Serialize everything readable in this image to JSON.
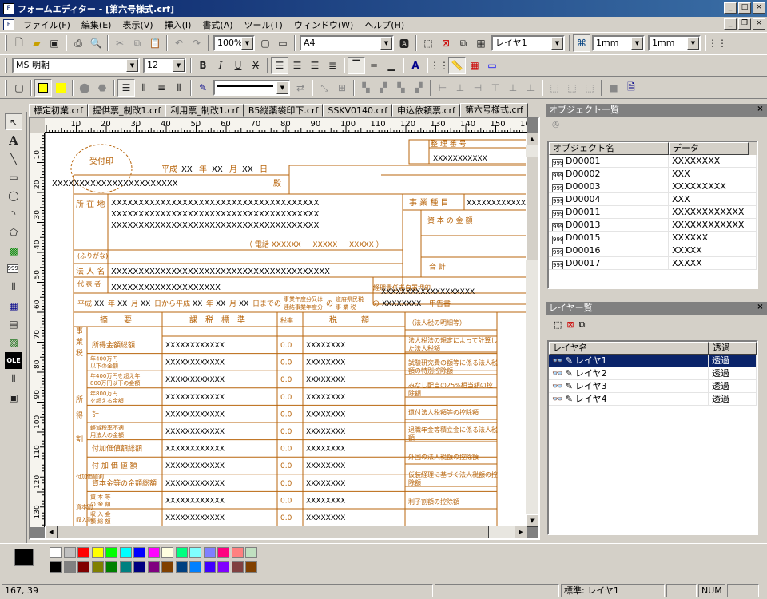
{
  "window": {
    "title": "フォームエディター - [第六号様式.crf]"
  },
  "menu": [
    "ファイル(F)",
    "編集(E)",
    "表示(V)",
    "挿入(I)",
    "書式(A)",
    "ツール(T)",
    "ウィンドウ(W)",
    "ヘルプ(H)"
  ],
  "toolbar1": {
    "zoom": "100%",
    "paper": "A4",
    "layer": "レイヤ1",
    "grid_x": "1mm",
    "grid_y": "1mm"
  },
  "toolbar2": {
    "font": "MS 明朝",
    "size": "12",
    "bold": "B",
    "italic": "I",
    "underline": "U",
    "strike": "X"
  },
  "tabs": [
    "標定初業.crf",
    "提供票_制改1.crf",
    "利用票_制改1.crf",
    "B5縦薬袋印下.crf",
    "SSKV0140.crf",
    "申込依頼票.crf",
    "第六号様式.crf"
  ],
  "ruler": {
    "h": [
      "10",
      "20",
      "30",
      "40",
      "50",
      "60",
      "70",
      "80",
      "90",
      "100",
      "110",
      "120",
      "130",
      "140",
      "150",
      "160"
    ],
    "v": [
      "10",
      "20",
      "30",
      "40",
      "50",
      "60",
      "70",
      "80",
      "90",
      "100",
      "110",
      "120",
      "130"
    ]
  },
  "form": {
    "stamp": "受付印",
    "heisei": "平成",
    "date_fields": [
      "XX",
      "年",
      "XX",
      "月",
      "XX",
      "日"
    ],
    "tax_office": "XXXXXXXXXXXXXXXXXXXXXXX",
    "tono": "殿",
    "addr_label": "所 在 地",
    "addr_lines": [
      "XXXXXXXXXXXXXXXXXXXXXXXXXXXXXXXXXXXXXX",
      "XXXXXXXXXXXXXXXXXXXXXXXXXXXXXXXXXXXXXX",
      "XXXXXXXXXXXXXXXXXXXXXXXXXXXXXXXXXXXXXX"
    ],
    "tel": "（ 電話 XXXXXX － XXXXX － XXXXX ）",
    "furigana": "(ふりがな)",
    "corp_label": "法 人 名",
    "corp_value": "XXXXXXXXXXXXXXXXXXXXXXXXXXXXXXXXXXXXXXXX",
    "rep_label": "代 表 者",
    "rep_value": "XXXXXXXXXXXXXXXXXXXX",
    "jigyo": "事 業 種 目",
    "jigyo_value": "XXXXXXXXXXXX",
    "shihon": "資 本 の 金 額",
    "gokei": "合 計",
    "keiri": "経理責任者自署押印",
    "keiri_value": "XXXXXXXXXXXXXXXXXXX",
    "seiri": "整 理 番 号",
    "seiri_value": "XXXXXXXXXXX",
    "period_line": [
      "平成",
      "XX",
      "年",
      "XX",
      "月",
      "XX",
      "日から平成",
      "XX",
      "年",
      "XX",
      "月",
      "XX",
      "日までの",
      "事業年度分又は連結事業年度分",
      "の",
      "道府県民税 事 業 税",
      "の",
      "XXXXXXXX",
      "申告書"
    ],
    "col_heads": [
      "摘　　要",
      "課　税　標　準",
      "税率",
      "税　　　額"
    ],
    "rows": [
      {
        "label": "所得金額総額",
        "value": "XXXXXXXXXXXX"
      },
      {
        "label": "年400万円以下の金額",
        "value": "XXXXXXXXXXXX"
      },
      {
        "label": "年400万円を超え年800万円以下の金額",
        "value": "XXXXXXXXXXXX"
      },
      {
        "label": "年800万円を超える金額",
        "value": "XXXXXXXXXXXX"
      },
      {
        "label": "計",
        "value": "XXXXXXXXXXXX"
      },
      {
        "label": "軽減税率不適用法人の金額",
        "value": "XXXXXXXXXXXX"
      },
      {
        "label": "付加価値額総額",
        "value": "XXXXXXXXXXXX"
      },
      {
        "label": "付 加 価 値 額",
        "value": "XXXXXXXXXXXX"
      },
      {
        "label": "資本金等の金額総額",
        "value": "XXXXXXXXXXXX"
      },
      {
        "label": "資 本 等 の 金 額",
        "value": "XXXXXXXXXXXX"
      },
      {
        "label": "収 入 金 額 総 額",
        "value": "XXXXXXXXXXXX"
      }
    ],
    "rate": "0.0",
    "tax_value": "XXXXXXXX",
    "side_labels": [
      "事",
      "業",
      "税",
      "所",
      "得",
      "割",
      "付加価値割",
      "資本割",
      "収入割"
    ],
    "right_rows": [
      "（法人税の明細等）",
      "法人税法の規定によって計算した法人税額",
      "試験研究費の額等に係る法人税額の特別控除額",
      "みなし配当の25%相当額の控除額",
      "還付法人税額等の控除額",
      "退職年金等積立金に係る法人税額",
      "外国の法人税額の控除額",
      "仮装経理に基づく法人税額の控除額",
      "利子割額の控除額"
    ]
  },
  "objects_panel": {
    "title": "オブジェクト一覧",
    "cols": [
      "オブジェクト名",
      "データ"
    ],
    "rows": [
      [
        "D00001",
        "XXXXXXXX"
      ],
      [
        "D00002",
        "XXX"
      ],
      [
        "D00003",
        "XXXXXXXXX"
      ],
      [
        "D00004",
        "XXX"
      ],
      [
        "D00011",
        "XXXXXXXXXXXX"
      ],
      [
        "D00013",
        "XXXXXXXXXXXX"
      ],
      [
        "D00015",
        "XXXXXX"
      ],
      [
        "D00016",
        "XXXXX"
      ],
      [
        "D00017",
        "XXXXX"
      ]
    ]
  },
  "layers_panel": {
    "title": "レイヤー覧",
    "cols": [
      "レイヤ名",
      "透過"
    ],
    "rows": [
      [
        "レイヤ1",
        "透過"
      ],
      [
        "レイヤ2",
        "透過"
      ],
      [
        "レイヤ3",
        "透過"
      ],
      [
        "レイヤ4",
        "透過"
      ]
    ]
  },
  "palette": {
    "row1": [
      "#ffffff",
      "#c0c0c0",
      "#ff0000",
      "#ffff00",
      "#00ff00",
      "#00ffff",
      "#0000ff",
      "#ff00ff",
      "#ffffe0",
      "#00ff80",
      "#80ffff",
      "#8080ff",
      "#ff0080",
      "#ff8080",
      "#c0e0c0"
    ],
    "row2": [
      "#000000",
      "#808080",
      "#800000",
      "#808000",
      "#008000",
      "#008080",
      "#000080",
      "#800080",
      "#804000",
      "#004080",
      "#0080ff",
      "#4000ff",
      "#8000ff",
      "#804040",
      "#804000"
    ]
  },
  "status": {
    "coords": "167, 39",
    "layer": "標準: レイヤ1",
    "num": "NUM"
  },
  "colors": {
    "form_line": "#b8650c",
    "title_bar": "#0a246a",
    "selection": "#0a246a"
  }
}
